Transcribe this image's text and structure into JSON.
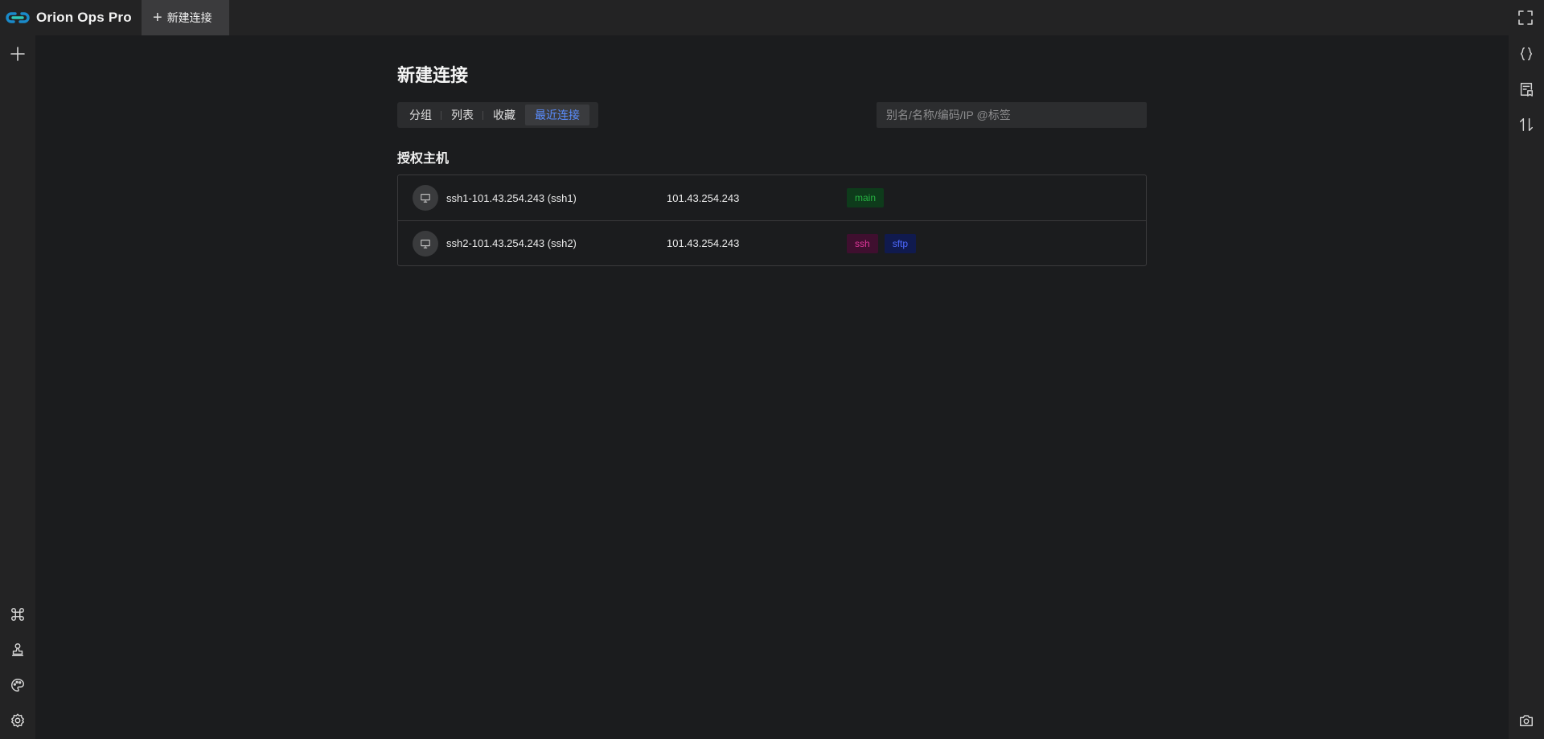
{
  "app": {
    "name": "Orion Ops Pro"
  },
  "top_tab": {
    "label": "新建连接"
  },
  "page": {
    "title": "新建连接",
    "view_tabs": [
      {
        "label": "分组",
        "active": false
      },
      {
        "label": "列表",
        "active": false
      },
      {
        "label": "收藏",
        "active": false
      },
      {
        "label": "最近连接",
        "active": true
      }
    ],
    "search_placeholder": "别名/名称/编码/IP @标签",
    "section_title": "授权主机"
  },
  "hosts": [
    {
      "name": "ssh1-101.43.254.243 (ssh1)",
      "ip": "101.43.254.243",
      "tags": [
        {
          "label": "main",
          "color": "#27b443",
          "bg": "#0e3b1b"
        }
      ]
    },
    {
      "name": "ssh2-101.43.254.243 (ssh2)",
      "ip": "101.43.254.243",
      "tags": [
        {
          "label": "ssh",
          "color": "#e0379a",
          "bg": "#3f0f2f"
        },
        {
          "label": "sftp",
          "color": "#4d69ff",
          "bg": "#101a4e"
        }
      ]
    }
  ],
  "left_sidebar_icons": [
    "plus-icon",
    "command-icon",
    "stamp-icon",
    "palette-icon",
    "gear-icon"
  ],
  "right_sidebar_icons": [
    "braces-icon",
    "snippet-icon",
    "transfer-icon",
    "camera-icon"
  ],
  "colors": {
    "accent": "#5a8dff",
    "background": "#1b1c1e",
    "panel": "#232324"
  }
}
